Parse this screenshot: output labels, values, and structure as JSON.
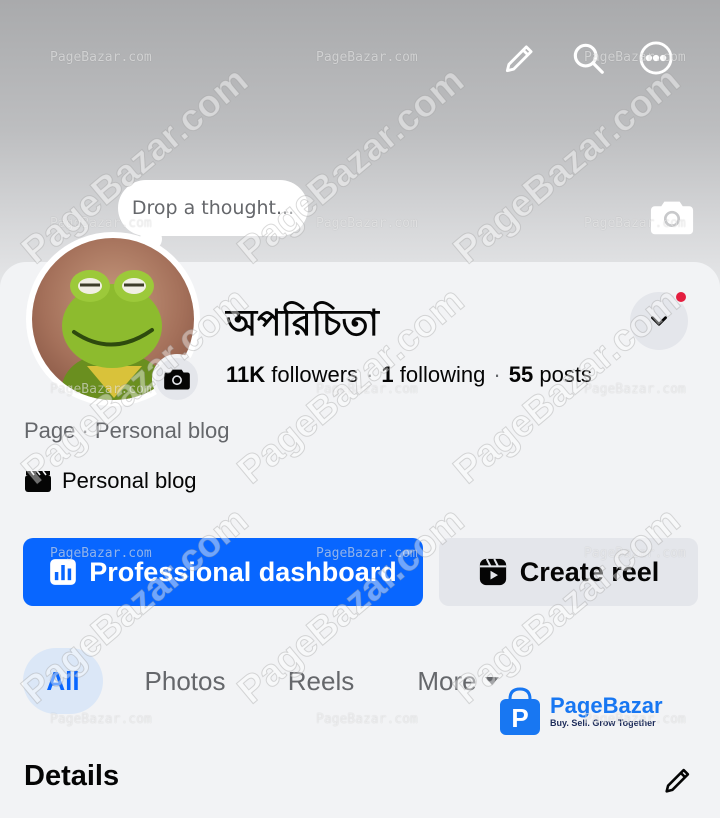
{
  "cover": {
    "icons": [
      "pencil-icon",
      "search-icon",
      "more-icon",
      "camera-icon"
    ]
  },
  "thought": {
    "placeholder": "Drop a thought..."
  },
  "profile": {
    "name": "অপরিচিতা",
    "followers_count": "11K",
    "followers_label": "followers",
    "following_count": "1",
    "following_label": "following",
    "posts_count": "55",
    "posts_label": "posts",
    "category": "Page · Personal blog",
    "blog_label": "Personal blog"
  },
  "actions": {
    "primary_label": "Professional dashboard",
    "secondary_label": "Create reel"
  },
  "tabs": [
    {
      "label": "All",
      "active": true
    },
    {
      "label": "Photos",
      "active": false
    },
    {
      "label": "Reels",
      "active": false
    },
    {
      "label": "More",
      "active": false
    }
  ],
  "details": {
    "title": "Details"
  },
  "watermark": {
    "small": "PageBazar.com",
    "big": "PageBazar.com",
    "logo_name": "PageBazar",
    "logo_tagline": "Buy. Sell. Grow Together"
  },
  "colors": {
    "primary": "#0866ff",
    "tab_active_bg": "#dbe7f7",
    "notification": "#e41e3f"
  }
}
